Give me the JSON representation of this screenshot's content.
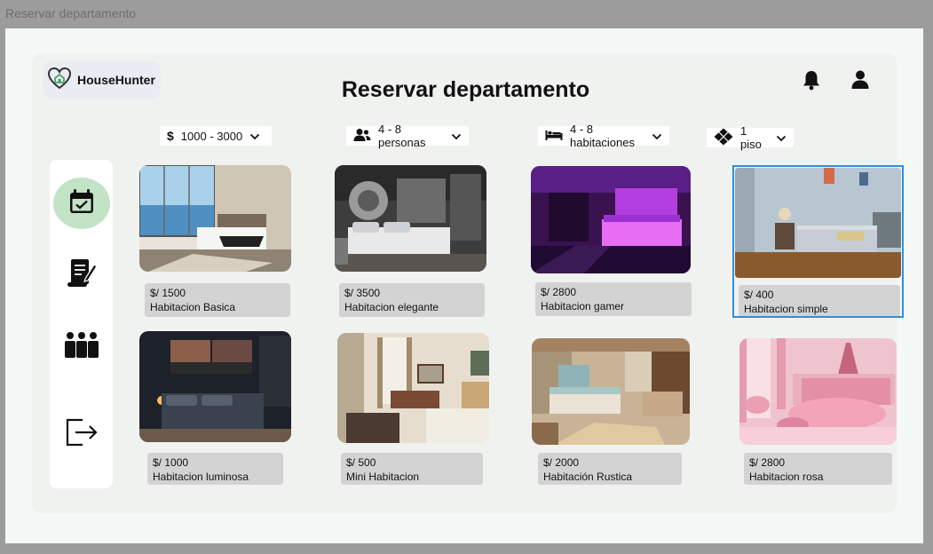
{
  "window_title": "Reservar departamento",
  "logo": {
    "text": "HouseHunter"
  },
  "page_title": "Reservar departamento",
  "filters": {
    "price": {
      "symbol": "$",
      "label": "1000 - 3000"
    },
    "people": {
      "label": "4 - 8 personas"
    },
    "rooms": {
      "label": "4 - 8 habitaciones"
    },
    "floor": {
      "label": "1 piso"
    }
  },
  "sidebar": {
    "items": [
      {
        "icon": "calendar-check-icon",
        "active": true
      },
      {
        "icon": "document-edit-icon",
        "active": false
      },
      {
        "icon": "group-people-icon",
        "active": false
      },
      {
        "icon": "logout-icon",
        "active": false
      }
    ]
  },
  "colors": {
    "active_nav": "#c3e3c6",
    "selection_border": "#2f8fdb",
    "info_bg": "#d3d3d3"
  },
  "listings": [
    {
      "price": "$/ 1500",
      "name": "Habitacion Basica"
    },
    {
      "price": "$/ 3500",
      "name": "Habitacion elegante"
    },
    {
      "price": "$/ 2800",
      "name": "Habitacion gamer"
    },
    {
      "price": "$/ 400",
      "name": "Habitacion simple",
      "selected": true
    },
    {
      "price": "$/ 1000",
      "name": "Habitacion luminosa"
    },
    {
      "price": "$/ 500",
      "name": "Mini Habitacion"
    },
    {
      "price": "$/ 2000",
      "name": "Habitación Rustica"
    },
    {
      "price": "$/ 2800",
      "name": "Habitacion rosa"
    }
  ]
}
